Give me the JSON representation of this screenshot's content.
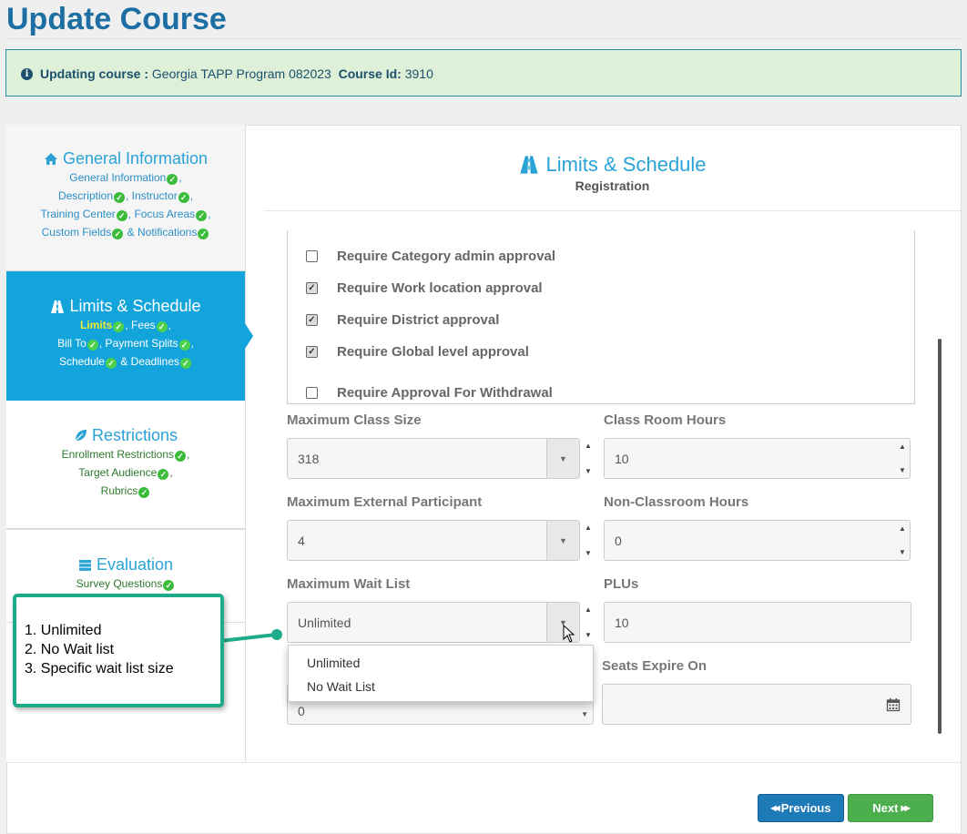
{
  "page": {
    "title": "Update Course"
  },
  "info": {
    "label": "Updating course :",
    "course_name": "Georgia TAPP Program 082023",
    "id_label": "Course Id:",
    "id_value": "3910"
  },
  "sidebar": {
    "general": {
      "title": "General Information",
      "items": [
        "General Information",
        "Description",
        "Instructor",
        "Training Center",
        "Focus Areas",
        "Custom Fields",
        "& Notifications"
      ]
    },
    "limits": {
      "title": "Limits & Schedule",
      "items": [
        "Limits",
        "Fees",
        "Bill To",
        "Payment Splits",
        "Schedule",
        "& Deadlines"
      ]
    },
    "restrictions": {
      "title": "Restrictions",
      "items": [
        "Enrollment Restrictions",
        "Target Audience",
        "Rubrics"
      ]
    },
    "evaluation": {
      "title": "Evaluation",
      "items": [
        "Survey Questions"
      ]
    }
  },
  "main": {
    "title": "Limits & Schedule",
    "subtitle": "Registration",
    "approvals": [
      {
        "label": "Require Category admin approval",
        "checked": false
      },
      {
        "label": "Require Work location approval",
        "checked": true
      },
      {
        "label": "Require District approval",
        "checked": true
      },
      {
        "label": "Require Global level approval",
        "checked": true
      },
      {
        "label": "Require Approval For Withdrawal",
        "checked": false
      }
    ],
    "fields": {
      "max_class_size": {
        "label": "Maximum Class Size",
        "value": "318"
      },
      "class_room_hours": {
        "label": "Class Room Hours",
        "value": "10"
      },
      "max_external": {
        "label": "Maximum External Participant",
        "value": "4"
      },
      "non_classroom_hours": {
        "label": "Non-Classroom Hours",
        "value": "0"
      },
      "max_wait_list": {
        "label": "Maximum Wait List",
        "value": "Unlimited"
      },
      "plus": {
        "label": "PLUs",
        "value": "10"
      },
      "hidden_field": {
        "value": "0"
      },
      "seats_expire": {
        "label": "Seats Expire On",
        "value": ""
      }
    },
    "wait_list_options": [
      "Unlimited",
      "No Wait List"
    ]
  },
  "callout": {
    "lines": [
      "1. Unlimited",
      "2. No Wait list",
      "3. Specific wait list size"
    ]
  },
  "buttons": {
    "previous": "Previous",
    "next": "Next"
  },
  "colors": {
    "primary": "#14a4dc",
    "title": "#1d6fa3",
    "success": "#4cae4c",
    "callout_border": "#1eab8a"
  }
}
